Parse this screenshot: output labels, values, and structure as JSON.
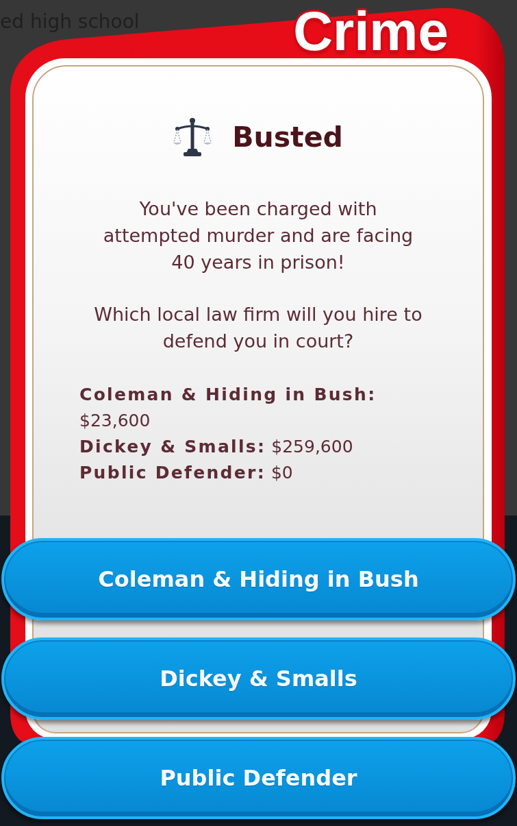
{
  "background": {
    "text": "ed high school"
  },
  "card": {
    "category": "Crime",
    "title": "Busted",
    "paragraphs": [
      "You've been charged with attempted murder and are facing 40 years in prison!",
      "Which local law firm will you hire to defend you in court?"
    ],
    "fees": [
      "**Coleman & Hiding in Bush:** $23,600",
      "**Dickey & Smalls:** $259,600",
      "**Public Defender:** $0"
    ]
  },
  "options": [
    {
      "label": "Coleman & Hiding in Bush"
    },
    {
      "label": "Dickey & Smalls"
    },
    {
      "label": "Public Defender"
    }
  ]
}
